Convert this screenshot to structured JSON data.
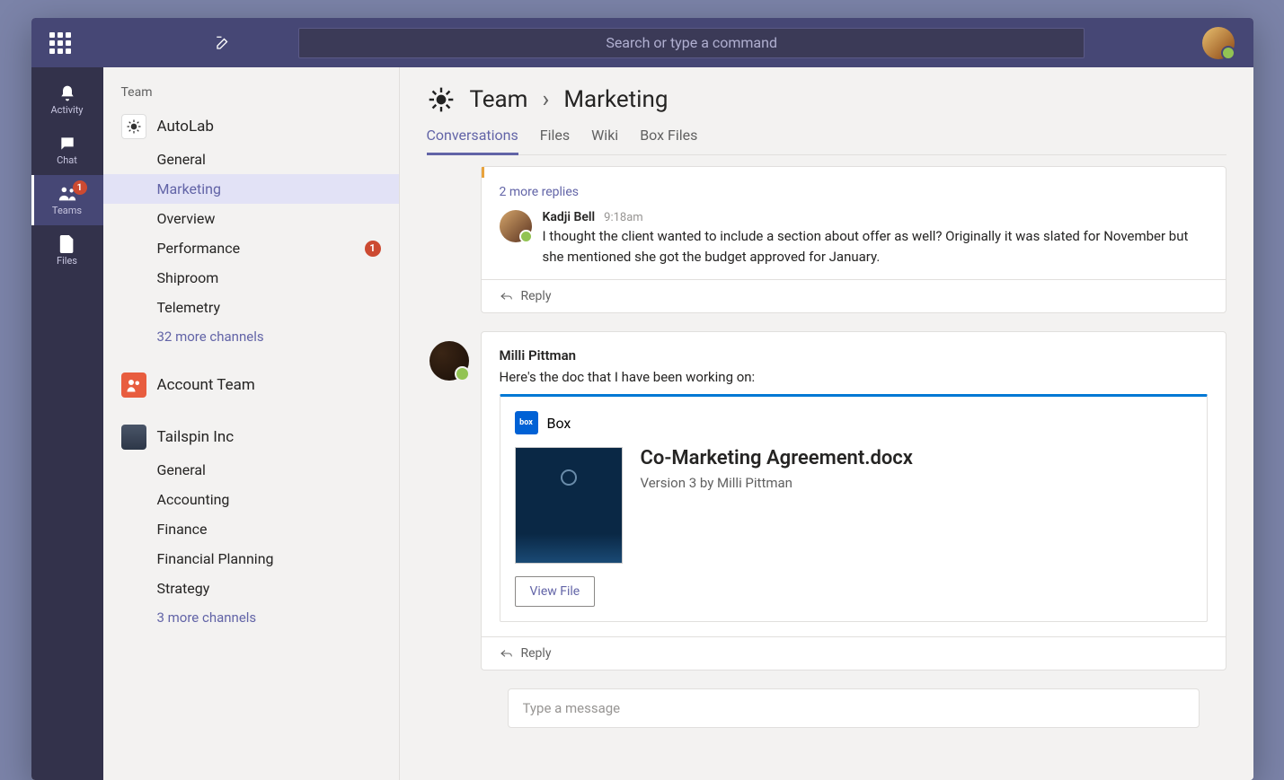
{
  "search": {
    "placeholder": "Search or type a command"
  },
  "apprail": {
    "activity": "Activity",
    "chat": "Chat",
    "teams": "Teams",
    "files": "Files",
    "teams_badge": "1"
  },
  "sidebar": {
    "header": "Team",
    "teams": [
      {
        "name": "AutoLab",
        "icon": "autolab",
        "channels": [
          {
            "label": "General",
            "active": false
          },
          {
            "label": "Marketing",
            "active": true
          },
          {
            "label": "Overview",
            "active": false
          },
          {
            "label": "Performance",
            "active": false,
            "badge": "1"
          },
          {
            "label": "Shiproom",
            "active": false
          },
          {
            "label": "Telemetry",
            "active": false
          }
        ],
        "more": "32 more channels"
      },
      {
        "name": "Account Team",
        "icon": "account",
        "channels": [],
        "more": null
      },
      {
        "name": "Tailspin Inc",
        "icon": "tailspin",
        "channels": [
          {
            "label": "General"
          },
          {
            "label": "Accounting"
          },
          {
            "label": "Finance"
          },
          {
            "label": "Financial Planning"
          },
          {
            "label": "Strategy"
          }
        ],
        "more": "3 more channels"
      }
    ]
  },
  "header": {
    "team": "Team",
    "channel": "Marketing",
    "tabs": [
      {
        "label": "Conversations",
        "active": true
      },
      {
        "label": "Files"
      },
      {
        "label": "Wiki"
      },
      {
        "label": "Box Files"
      }
    ]
  },
  "thread1": {
    "more_replies": "2 more replies",
    "reply": {
      "author": "Kadji Bell",
      "time": "9:18am",
      "text": "I thought the client wanted to include a section about offer as well? Originally it was slated for November but she mentioned she got the budget approved for January."
    },
    "reply_label": "Reply"
  },
  "post": {
    "author": "Milli Pittman",
    "text": "Here's the doc that I have been working on:",
    "attachment": {
      "provider": "Box",
      "title": "Co-Marketing Agreement.docx",
      "meta": "Version 3 by Milli Pittman",
      "button": "View File"
    },
    "reply_label": "Reply"
  },
  "compose": {
    "placeholder": "Type a message"
  }
}
